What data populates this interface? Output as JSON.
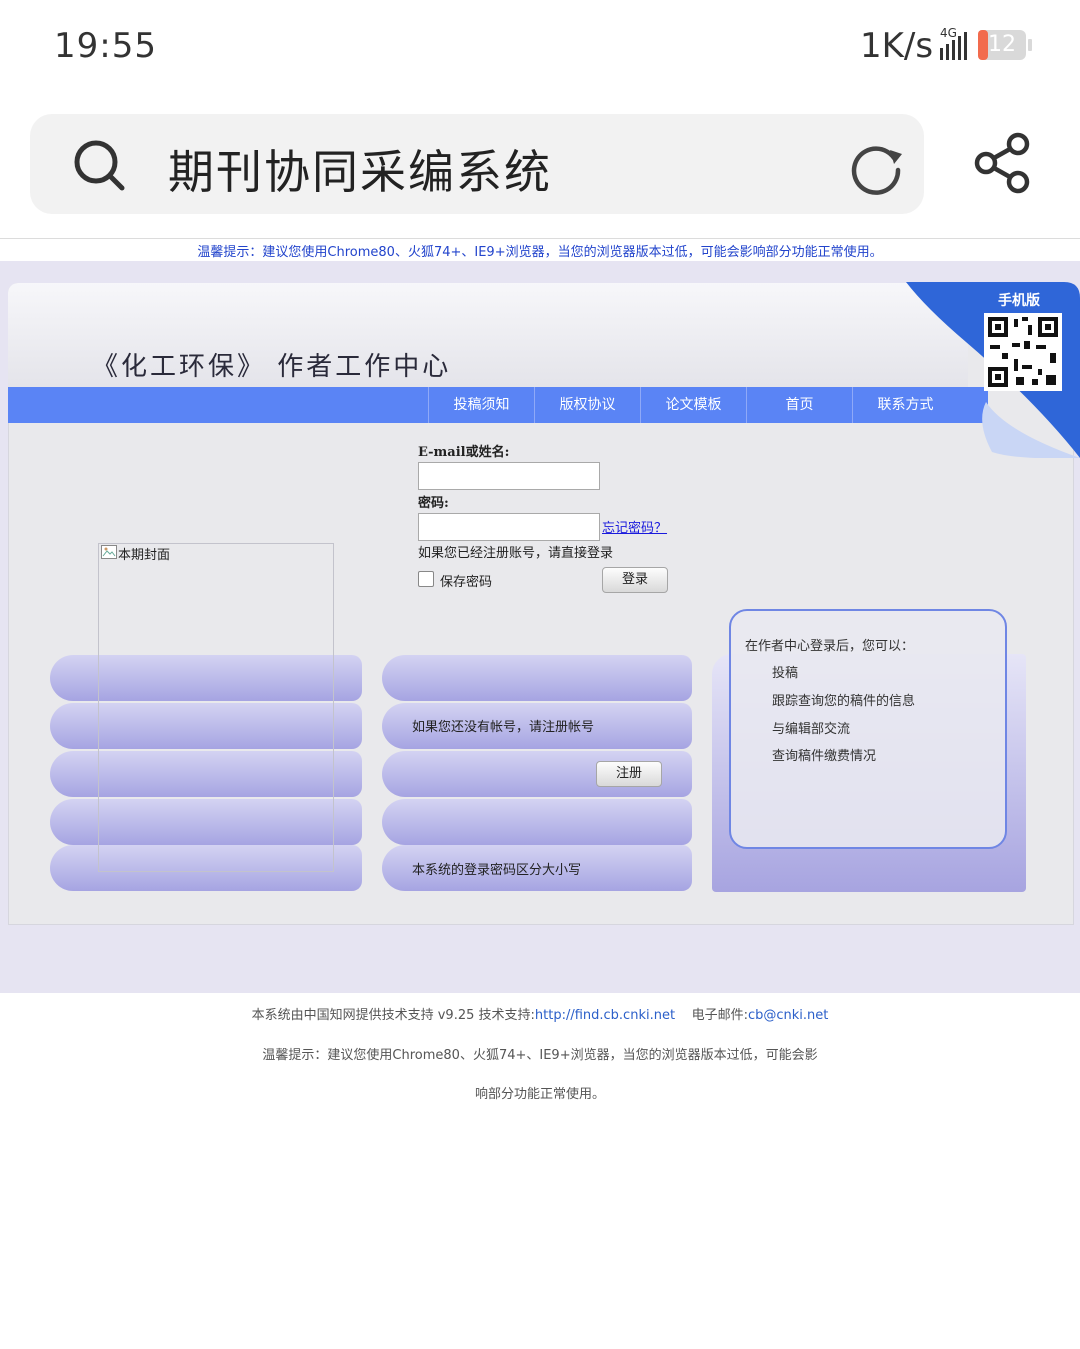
{
  "status_bar": {
    "time": "19:55",
    "speed": "1K/s",
    "network": "4G",
    "battery": "12"
  },
  "browser": {
    "title": "期刊协同采编系统"
  },
  "notice_top": "温馨提示：建议您使用Chrome80、火狐74+、IE9+浏览器，当您的浏览器版本过低，可能会影响部分功能正常使用。",
  "header": {
    "site_title": "《化工环保》  作者工作中心",
    "mobile_label": "手机版",
    "nav": [
      "投稿须知",
      "版权协议",
      "论文模板",
      "首页",
      "联系方式"
    ]
  },
  "login": {
    "email_label": "E-mail或姓名:",
    "email_value": "",
    "password_label": "密码:",
    "password_value": "",
    "forgot_link": "忘记密码？",
    "registered_hint": "如果您已经注册账号，请直接登录",
    "remember_label": "保存密码",
    "login_button": "登录"
  },
  "cover": {
    "label": "本期封面"
  },
  "register": {
    "hint": "如果您还没有帐号，请注册帐号",
    "button": "注册",
    "case_hint": "本系统的登录密码区分大小写"
  },
  "info": {
    "title": "在作者中心登录后，您可以：",
    "items": [
      "投稿",
      "跟踪查询您的稿件的信息",
      "与编辑部交流",
      "查询稿件缴费情况"
    ]
  },
  "footer": {
    "support_prefix": "本系统由中国知网提供技术支持 v9.25   技术支持:",
    "support_link": "http://find.cb.cnki.net",
    "email_prefix": "电子邮件:",
    "email_link": "cb@cnki.net",
    "notice_line1": "温馨提示：建议您使用Chrome80、火狐74+、IE9+浏览器，当您的浏览器版本过低，可能会影",
    "notice_line2": "响部分功能正常使用。"
  }
}
